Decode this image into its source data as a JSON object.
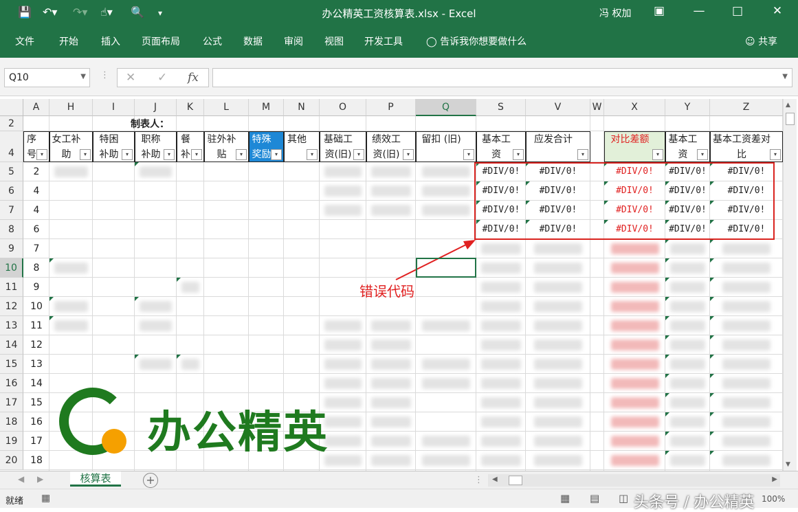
{
  "window": {
    "title": "办公精英工资核算表.xlsx - Excel",
    "user": "冯 权加"
  },
  "ribbon": {
    "tabs": [
      "文件",
      "开始",
      "插入",
      "页面布局",
      "公式",
      "数据",
      "审阅",
      "视图",
      "开发工具"
    ],
    "tell_me": "告诉我你想要做什么",
    "share": "共享"
  },
  "formula_bar": {
    "name_box": "Q10",
    "fx_label": "fx",
    "formula": ""
  },
  "columns": [
    "A",
    "H",
    "I",
    "J",
    "K",
    "L",
    "M",
    "N",
    "O",
    "P",
    "Q",
    "S",
    "V",
    "W",
    "X",
    "Y",
    "Z"
  ],
  "rows": [
    "2",
    "4",
    "5",
    "6",
    "7",
    "8",
    "9",
    "10",
    "11",
    "12",
    "13",
    "14",
    "15",
    "16",
    "17",
    "18",
    "19",
    "20"
  ],
  "sheet": {
    "row2_label": "制表人：",
    "headers": {
      "A": "序号",
      "H": "女工补助",
      "I": "特困补助",
      "J": "职称补助",
      "K": "餐补",
      "L": "驻外补贴",
      "M": "特殊奖励",
      "N": "其他",
      "O": "基础工资(旧)",
      "P": "绩效工资(旧)",
      "Q": "留扣 (旧)",
      "S": "基本工资",
      "V": "应发合计",
      "X": "对比差额",
      "Y": "基本工资",
      "Z": "基本工资差对比"
    },
    "seq": [
      "2",
      "4",
      "4",
      "6",
      "7",
      "8",
      "9",
      "10",
      "11",
      "12",
      "13",
      "14",
      "15",
      "16",
      "17",
      "18"
    ],
    "error_value": "#DIV/0!"
  },
  "annotation": "错误代码",
  "logo_text": "办公精英",
  "sheet_tabs": [
    "核算表"
  ],
  "status": {
    "ready": "就绪",
    "zoom": "100%"
  },
  "watermark": "头条号 / 办公精英",
  "colors": {
    "excel_green": "#217346",
    "error_red": "#e02020",
    "highlight_box": "#d9231f",
    "logo_green": "#1f7a1f",
    "logo_orange": "#f5a000"
  }
}
